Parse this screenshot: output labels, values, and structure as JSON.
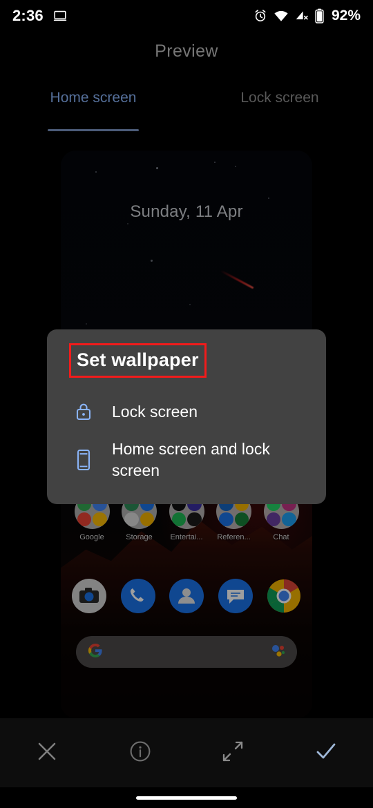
{
  "status_bar": {
    "time": "2:36",
    "battery_percent": "92%",
    "icons": [
      "cast-screen-icon",
      "alarm-icon",
      "wifi-icon",
      "cellular-off-icon",
      "battery-icon"
    ]
  },
  "header": {
    "title": "Preview"
  },
  "tabs": [
    {
      "label": "Home screen",
      "active": true
    },
    {
      "label": "Lock screen",
      "active": false
    }
  ],
  "preview": {
    "date_widget": "Sunday, 11 Apr",
    "folders": [
      {
        "label": "Google"
      },
      {
        "label": "Storage"
      },
      {
        "label": "Entertai..."
      },
      {
        "label": "Referen..."
      },
      {
        "label": "Chat"
      }
    ],
    "dock": [
      {
        "name": "camera"
      },
      {
        "name": "phone"
      },
      {
        "name": "contacts"
      },
      {
        "name": "messages"
      },
      {
        "name": "chrome"
      }
    ],
    "search_bar": {
      "left_icon": "google-g-icon",
      "right_icon": "assistant-icon",
      "value": ""
    }
  },
  "dialog": {
    "title": "Set wallpaper",
    "title_highlight_color": "#f21b1b",
    "options": [
      {
        "label": "Lock screen",
        "icon": "lock-icon"
      },
      {
        "label": "Home screen and lock screen",
        "icon": "smartphone-icon"
      }
    ]
  },
  "bottom_bar": {
    "buttons": [
      {
        "name": "close",
        "icon": "close-icon"
      },
      {
        "name": "info",
        "icon": "info-circle-icon"
      },
      {
        "name": "expand",
        "icon": "expand-arrows-icon"
      },
      {
        "name": "confirm",
        "icon": "check-icon"
      }
    ]
  },
  "colors": {
    "accent": "#8ab4f8",
    "dialog_bg": "#424242",
    "highlight": "#f21b1b"
  }
}
